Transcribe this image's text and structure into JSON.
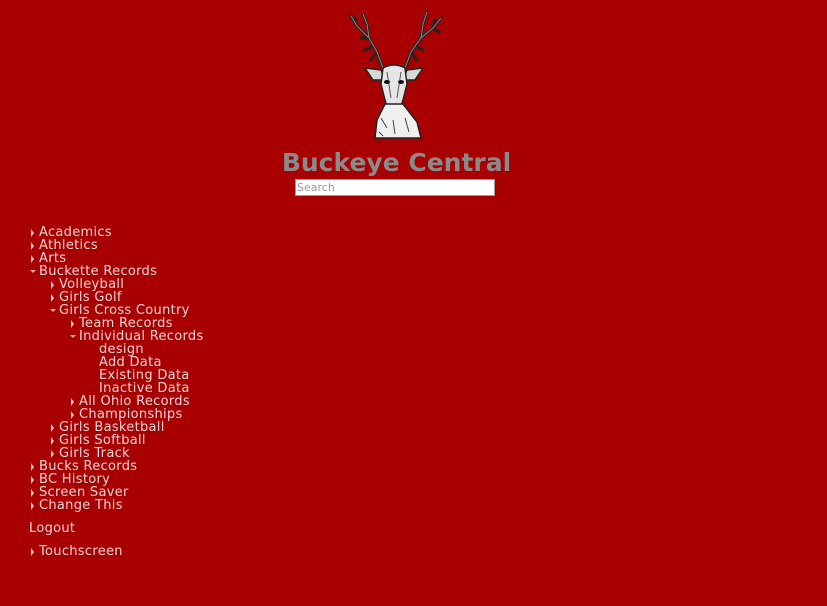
{
  "header": {
    "title": "Buckeye Central",
    "logo_icon": "deer-head-logo"
  },
  "search": {
    "placeholder": "Search",
    "value": ""
  },
  "nav": {
    "academics": "Academics",
    "athletics": "Athletics",
    "arts": "Arts",
    "buckette_records": "Buckette Records",
    "volleyball": "Volleyball",
    "girls_golf": "Girls Golf",
    "girls_cross_country": "Girls Cross Country",
    "team_records": "Team Records",
    "individual_records": "Individual Records",
    "design": "design",
    "add_data": "Add Data",
    "existing_data": "Existing Data",
    "inactive_data": "Inactive Data",
    "all_ohio_records": "All Ohio Records",
    "championships": "Championships",
    "girls_basketball": "Girls Basketball",
    "girls_softball": "Girls Softball",
    "girls_track": "Girls Track",
    "bucks_records": "Bucks Records",
    "bc_history": "BC History",
    "screen_saver": "Screen Saver",
    "change_this": "Change This",
    "logout": "Logout",
    "touchscreen": "Touchscreen"
  },
  "colors": {
    "background": "#a80000",
    "title": "#8a8a8a",
    "nav_text": "#e8d6d6"
  }
}
